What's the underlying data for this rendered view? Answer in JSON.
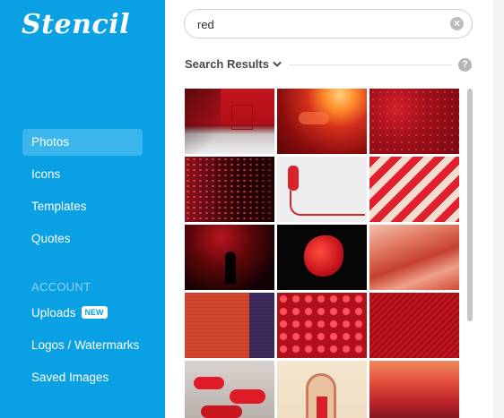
{
  "app": {
    "logo": "Stencil"
  },
  "sidebar": {
    "items": [
      {
        "label": "Photos",
        "active": true
      },
      {
        "label": "Icons"
      },
      {
        "label": "Templates"
      },
      {
        "label": "Quotes"
      }
    ],
    "section_label": "ACCOUNT",
    "account_items": [
      {
        "label": "Uploads",
        "badge": "NEW"
      },
      {
        "label": "Logos / Watermarks"
      },
      {
        "label": "Saved Images"
      }
    ]
  },
  "search": {
    "value": "red",
    "clear_icon": "close-circle-icon"
  },
  "results": {
    "title": "Search Results",
    "help_icon": "question-circle-icon",
    "images": [
      {
        "name": "red-wall-shadow"
      },
      {
        "name": "red-sunset-sky"
      },
      {
        "name": "red-roses-field"
      },
      {
        "name": "red-led-lights-perspective"
      },
      {
        "name": "red-telephone-on-white"
      },
      {
        "name": "red-white-diagonal-stripes"
      },
      {
        "name": "person-red-smoke"
      },
      {
        "name": "red-betta-fish"
      },
      {
        "name": "red-rock-canyon"
      },
      {
        "name": "red-brick-wall"
      },
      {
        "name": "red-raspberries"
      },
      {
        "name": "red-diagonal-texture"
      },
      {
        "name": "red-fabric-on-street"
      },
      {
        "name": "red-door-arch"
      },
      {
        "name": "red-sunset-clouds"
      }
    ]
  },
  "colors": {
    "sidebar": "#0aa0e4",
    "active_item": "#3bb6ec",
    "section_label": "#8fd0f2"
  }
}
